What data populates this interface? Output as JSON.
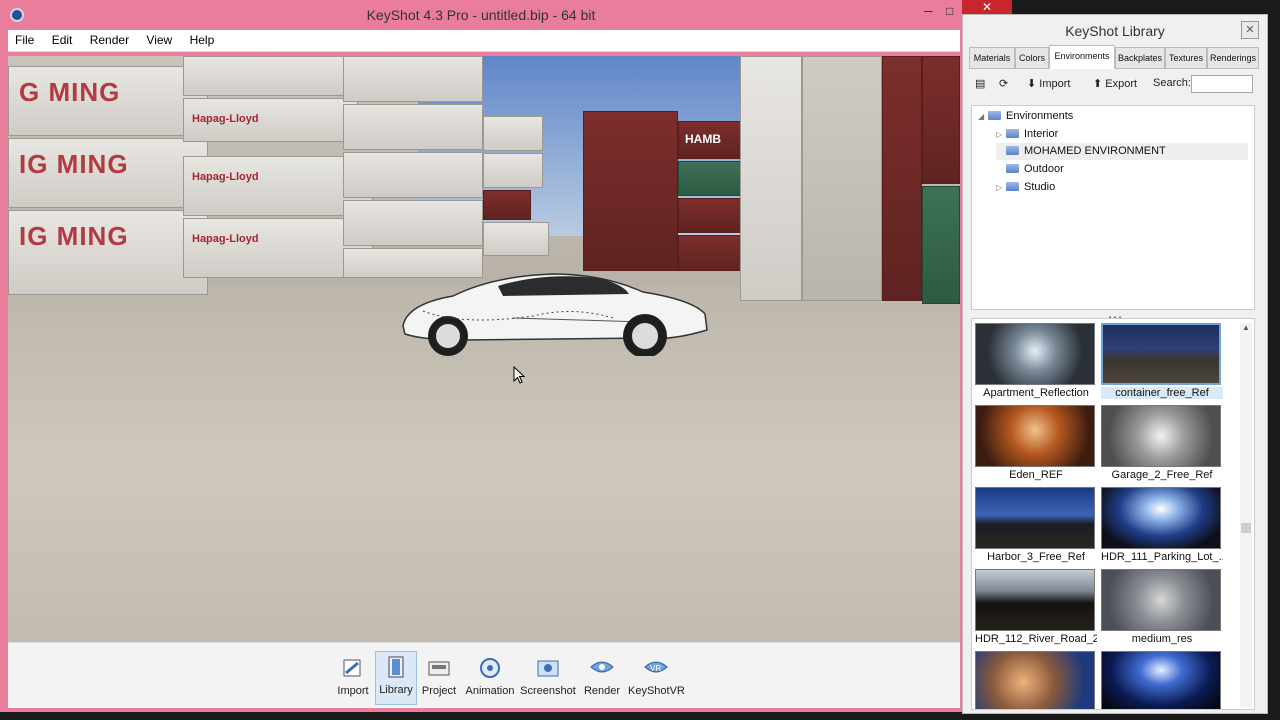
{
  "window": {
    "title": "KeyShot 4.3 Pro  - untitled.bip  - 64 bit",
    "minimize": "─",
    "maximize": "□",
    "close": "✕"
  },
  "menu": [
    "File",
    "Edit",
    "Render",
    "View",
    "Help"
  ],
  "viewport": {
    "container_text_1": "G MING",
    "container_text_2": "IG MING",
    "container_text_3": "IG MING",
    "hapag_1": "Hapag-Lloyd",
    "hapag_2": "Hapag-Lloyd",
    "hapag_3": "Hapag-Lloyd",
    "hamb": "HAMB"
  },
  "toolbar": [
    {
      "label": "Import",
      "icon": "import-icon",
      "active": false
    },
    {
      "label": "Library",
      "icon": "library-icon",
      "active": true
    },
    {
      "label": "Project",
      "icon": "project-icon",
      "active": false
    },
    {
      "label": "Animation",
      "icon": "animation-icon",
      "active": false
    },
    {
      "label": "Screenshot",
      "icon": "screenshot-icon",
      "active": false
    },
    {
      "label": "Render",
      "icon": "render-icon",
      "active": false
    },
    {
      "label": "KeyShotVR",
      "icon": "keyshotvr-icon",
      "active": false
    }
  ],
  "library": {
    "title": "KeyShot Library",
    "close": "✕",
    "tabs": [
      "Materials",
      "Colors",
      "Environments",
      "Backplates",
      "Textures",
      "Renderings"
    ],
    "active_tab": "Environments",
    "import_label": "Import",
    "export_label": "Export",
    "search_label": "Search:",
    "search_value": "",
    "tree": {
      "root": "Environments",
      "children": [
        "Interior",
        "MOHAMED ENVIRONMENT",
        "Outdoor",
        "Studio"
      ],
      "selected": "MOHAMED ENVIRONMENT"
    },
    "thumbnails": [
      {
        "label": "Apartment_Reflection",
        "selected": false
      },
      {
        "label": "container_free_Ref",
        "selected": true
      },
      {
        "label": "Eden_REF",
        "selected": false
      },
      {
        "label": "Garage_2_Free_Ref",
        "selected": false
      },
      {
        "label": "Harbor_3_Free_Ref",
        "selected": false
      },
      {
        "label": "HDR_111_Parking_Lot_...",
        "selected": false
      },
      {
        "label": "HDR_112_River_Road_2...",
        "selected": false
      },
      {
        "label": "medium_res",
        "selected": false
      },
      {
        "label": "",
        "selected": false
      },
      {
        "label": "",
        "selected": false
      }
    ],
    "colors": {
      "accent": "#6ea4db",
      "selection": "#dbe9f6"
    }
  }
}
